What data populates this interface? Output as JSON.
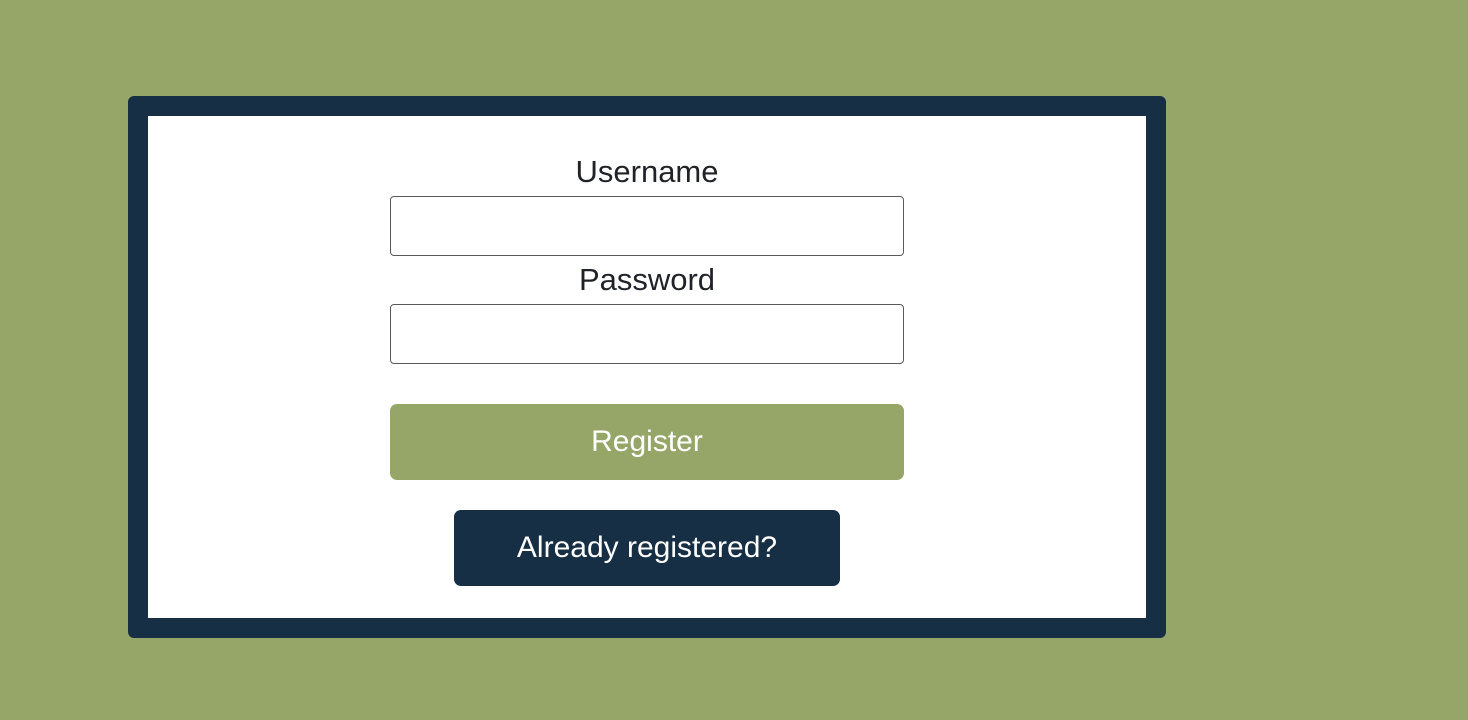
{
  "form": {
    "username_label": "Username",
    "username_value": "",
    "password_label": "Password",
    "password_value": "",
    "register_label": "Register",
    "already_registered_label": "Already registered?"
  },
  "colors": {
    "background": "#96a668",
    "card_border": "#162f44",
    "card_fill": "#ffffff",
    "register_button": "#96a668",
    "secondary_button": "#162f44"
  }
}
